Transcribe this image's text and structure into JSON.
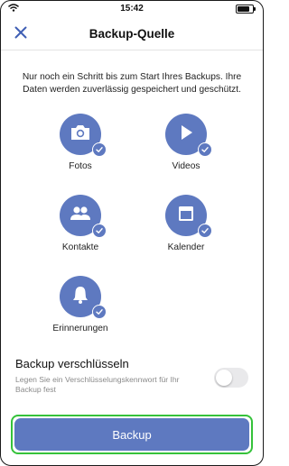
{
  "status_bar": {
    "time": "15:42"
  },
  "header": {
    "title": "Backup-Quelle",
    "close_icon": "close-icon"
  },
  "intro": "Nur noch ein Schritt bis zum Start Ihres Backups. Ihre Daten werden zuverlässig gespeichert und geschützt.",
  "sources": [
    {
      "label": "Fotos",
      "icon": "camera-icon",
      "checked": true
    },
    {
      "label": "Videos",
      "icon": "play-icon",
      "checked": true
    },
    {
      "label": "Kontakte",
      "icon": "contacts-icon",
      "checked": true
    },
    {
      "label": "Kalender",
      "icon": "calendar-icon",
      "checked": true
    },
    {
      "label": "Erinnerungen",
      "icon": "bell-icon",
      "checked": true
    }
  ],
  "encryption": {
    "title": "Backup verschlüsseln",
    "subtitle": "Legen Sie ein Verschlüsselungskennwort für Ihr Backup fest",
    "enabled": false
  },
  "backup_button": {
    "label": "Backup"
  },
  "colors": {
    "accent": "#5e79c0",
    "highlight": "#35c23a"
  }
}
